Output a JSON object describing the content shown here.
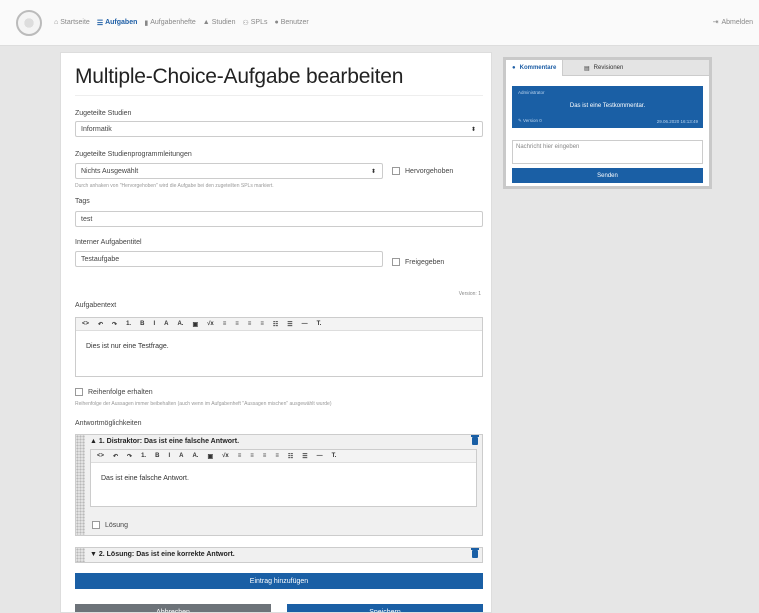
{
  "nav": {
    "items": [
      {
        "icon": "home-icon",
        "glyph": "⌂",
        "label": "Startseite"
      },
      {
        "icon": "list-icon",
        "glyph": "☰",
        "label": "Aufgaben"
      },
      {
        "icon": "book-icon",
        "glyph": "▮",
        "label": "Aufgabenhefte"
      },
      {
        "icon": "graduation-icon",
        "glyph": "▲",
        "label": "Studien"
      },
      {
        "icon": "users-icon",
        "glyph": "⚇",
        "label": "SPLs"
      },
      {
        "icon": "user-icon",
        "glyph": "●",
        "label": "Benutzer"
      }
    ],
    "logout": {
      "icon": "sign-out-icon",
      "glyph": "⇥",
      "label": "Abmelden"
    }
  },
  "form": {
    "title": "Multiple-Choice-Aufgabe bearbeiten",
    "studies_label": "Zugeteilte Studien",
    "studies_value": "Informatik",
    "spl_label": "Zugeteilte Studienprogrammleitungen",
    "spl_value": "Nichts Ausgewählt",
    "highlighted_label": "Hervorgehoben",
    "spl_help": "Durch anhaken von \"Hervorgehoben\" wird die Aufgabe bei den zugeteilten SPLs markiert.",
    "tags_label": "Tags",
    "tags_value": "test",
    "internal_title_label": "Interner Aufgabentitel",
    "internal_title_value": "Testaufgabe",
    "approved_label": "Freigegeben",
    "version": "Version: 1",
    "task_text_label": "Aufgabentext",
    "task_text": "Dies ist nur eine Testfrage.",
    "keep_order_label": "Reihenfolge erhalten",
    "keep_order_help": "Reihenfolge der Aussagen immer beibehalten (auch wenn im Aufgabenheft \"Aussagen mischen\" ausgewählt wurde)",
    "answers_label": "Antwortmöglichkeiten",
    "answers": [
      {
        "header": "▲ 1. Distraktor: Das ist eine falsche Antwort.",
        "text": "Das ist eine falsche Antwort.",
        "solution_label": "Lösung"
      },
      {
        "header": "▼ 2. Lösung: Das ist eine korrekte Antwort."
      }
    ],
    "add_entry": "Eintrag hinzufügen",
    "cancel": "Abbrechen",
    "save": "Speichern"
  },
  "toolbar": [
    "<>",
    "↶",
    "↷",
    "1.",
    "B",
    "I",
    "A",
    "A.",
    "▣",
    "√x",
    "≡",
    "≡",
    "≡",
    "≡",
    "☷",
    "☰",
    "—",
    "T."
  ],
  "side": {
    "tab_comments": "Kommentare",
    "tab_revisions": "Revisionen",
    "comment_author": "Administrator",
    "comment_text": "Das ist eine Testkommentar.",
    "comment_version": "Version 0",
    "comment_date": "29.06.2020 16:13:49",
    "message_placeholder": "Nachricht hier eingeben",
    "send": "Senden"
  },
  "colors": {
    "primary": "#1a5fa5",
    "secondary": "#6d7379"
  }
}
